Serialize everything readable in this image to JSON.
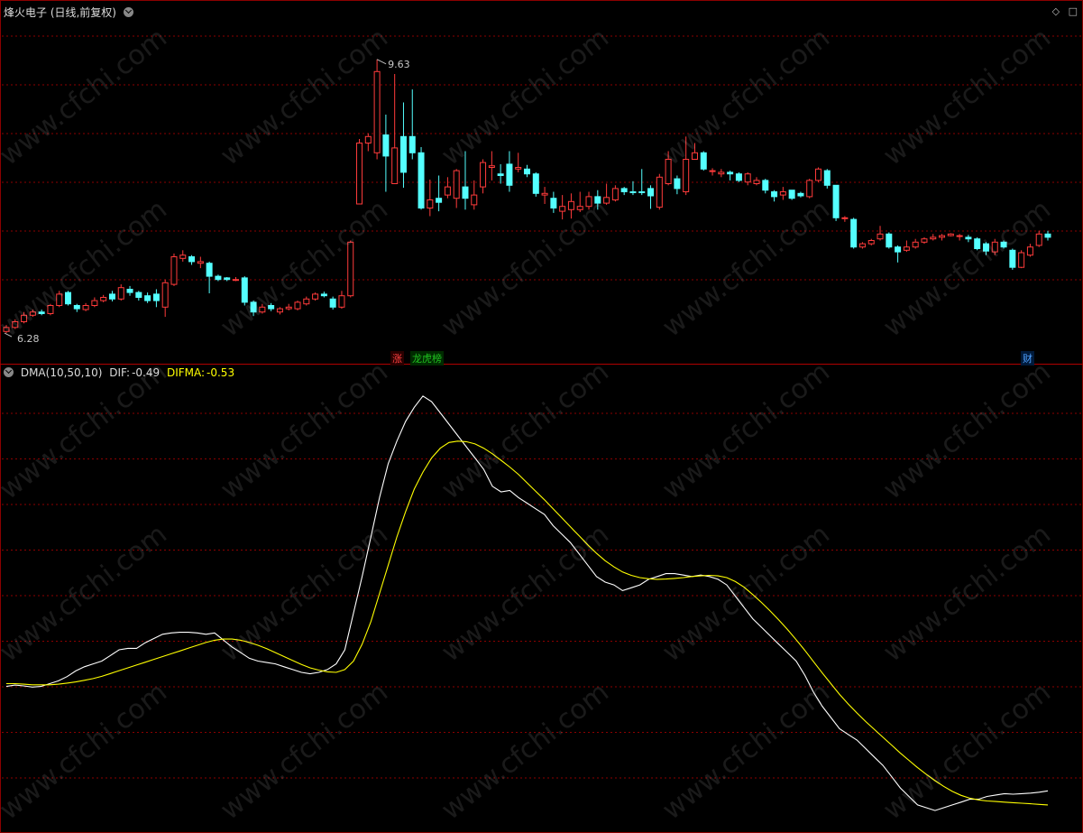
{
  "header": {
    "title": "烽火电子 (日线,前复权)"
  },
  "top_icons": [
    "diamond-icon",
    "square-icon"
  ],
  "price_panel": {
    "high_label": "9.63",
    "low_label": "6.28",
    "markers": [
      {
        "text": "涨",
        "color": "#ff4040"
      },
      {
        "text": "龙虎榜",
        "color": "#20c020"
      },
      {
        "text": "财",
        "color": "#4fa0ff"
      }
    ]
  },
  "indicator_panel": {
    "name": "DMA(10,50,10)",
    "dif_label": "DIF:",
    "dif_value": "-0.49",
    "difma_label": "DIFMA:",
    "difma_value": "-0.53"
  },
  "watermark": "www.cfchi.com",
  "colors": {
    "up": "#ff3b3b",
    "down": "#54ffff",
    "grid": "#8b0000",
    "dif": "#ffffff",
    "difma": "#ffff00",
    "text": "#c8c8c8"
  },
  "chart_data": [
    {
      "type": "candlestick",
      "title": "烽火电子 (日线,前复权)",
      "ylim": [
        6.05,
        10.05
      ],
      "candles": [
        [
          6.28,
          6.33,
          6.26,
          6.36
        ],
        [
          6.33,
          6.4,
          6.31,
          6.43
        ],
        [
          6.4,
          6.48,
          6.38,
          6.52
        ],
        [
          6.48,
          6.52,
          6.46,
          6.55
        ],
        [
          6.52,
          6.5,
          6.48,
          6.55
        ],
        [
          6.5,
          6.6,
          6.48,
          6.62
        ],
        [
          6.6,
          6.74,
          6.58,
          6.78
        ],
        [
          6.76,
          6.62,
          6.6,
          6.78
        ],
        [
          6.6,
          6.56,
          6.52,
          6.62
        ],
        [
          6.55,
          6.6,
          6.53,
          6.63
        ],
        [
          6.6,
          6.66,
          6.58,
          6.7
        ],
        [
          6.66,
          6.7,
          6.64,
          6.73
        ],
        [
          6.74,
          6.68,
          6.65,
          6.78
        ],
        [
          6.68,
          6.82,
          6.66,
          6.86
        ],
        [
          6.8,
          6.76,
          6.72,
          6.84
        ],
        [
          6.76,
          6.7,
          6.66,
          6.78
        ],
        [
          6.72,
          6.66,
          6.63,
          6.76
        ],
        [
          6.74,
          6.66,
          6.58,
          6.8
        ],
        [
          6.58,
          6.88,
          6.46,
          6.92
        ],
        [
          6.86,
          7.2,
          6.84,
          7.24
        ],
        [
          7.18,
          7.22,
          7.14,
          7.28
        ],
        [
          7.2,
          7.14,
          7.1,
          7.22
        ],
        [
          7.12,
          7.14,
          7.06,
          7.2
        ],
        [
          7.12,
          6.96,
          6.75,
          7.14
        ],
        [
          6.96,
          6.92,
          6.9,
          6.98
        ],
        [
          6.94,
          6.92,
          6.9,
          6.95
        ],
        [
          6.92,
          6.92,
          6.9,
          6.95
        ],
        [
          6.94,
          6.64,
          6.6,
          6.96
        ],
        [
          6.64,
          6.52,
          6.47,
          6.66
        ],
        [
          6.52,
          6.58,
          6.5,
          6.62
        ],
        [
          6.6,
          6.56,
          6.53,
          6.63
        ],
        [
          6.52,
          6.56,
          6.49,
          6.58
        ],
        [
          6.56,
          6.58,
          6.54,
          6.62
        ],
        [
          6.56,
          6.64,
          6.54,
          6.66
        ],
        [
          6.62,
          6.68,
          6.6,
          6.71
        ],
        [
          6.68,
          6.74,
          6.66,
          6.76
        ],
        [
          6.74,
          6.72,
          6.7,
          6.77
        ],
        [
          6.68,
          6.58,
          6.55,
          6.71
        ],
        [
          6.58,
          6.72,
          6.56,
          6.78
        ],
        [
          6.72,
          7.38,
          6.7,
          7.4
        ],
        [
          7.85,
          8.6,
          7.85,
          8.65
        ],
        [
          8.6,
          8.68,
          8.5,
          8.72
        ],
        [
          8.48,
          9.48,
          8.4,
          9.63
        ],
        [
          8.7,
          8.44,
          8.0,
          8.95
        ],
        [
          8.1,
          8.54,
          8.1,
          9.45
        ],
        [
          8.68,
          8.24,
          8.05,
          9.1
        ],
        [
          8.68,
          8.48,
          8.4,
          9.26
        ],
        [
          8.48,
          7.8,
          7.78,
          8.55
        ],
        [
          7.8,
          7.9,
          7.7,
          8.15
        ],
        [
          7.92,
          7.87,
          7.76,
          8.2
        ],
        [
          7.96,
          8.06,
          7.92,
          8.18
        ],
        [
          7.92,
          8.26,
          7.8,
          8.28
        ],
        [
          8.06,
          7.92,
          7.78,
          8.5
        ],
        [
          7.84,
          7.96,
          7.78,
          8.14
        ],
        [
          8.06,
          8.36,
          7.98,
          8.4
        ],
        [
          8.3,
          8.32,
          8.14,
          8.5
        ],
        [
          8.22,
          8.2,
          8.1,
          8.34
        ],
        [
          8.34,
          8.08,
          8.0,
          8.5
        ],
        [
          8.28,
          8.3,
          8.24,
          8.48
        ],
        [
          8.28,
          8.22,
          8.18,
          8.33
        ],
        [
          8.22,
          7.98,
          7.94,
          8.24
        ],
        [
          7.96,
          7.98,
          7.85,
          8.06
        ],
        [
          7.92,
          7.8,
          7.74,
          8.0
        ],
        [
          7.76,
          7.82,
          7.66,
          7.96
        ],
        [
          7.78,
          7.88,
          7.67,
          7.98
        ],
        [
          7.78,
          7.82,
          7.75,
          8.0
        ],
        [
          7.82,
          7.94,
          7.78,
          8.0
        ],
        [
          7.94,
          7.86,
          7.78,
          8.02
        ],
        [
          7.86,
          7.93,
          7.84,
          8.1
        ],
        [
          7.9,
          8.04,
          7.88,
          8.08
        ],
        [
          8.04,
          8.0,
          7.96,
          8.06
        ],
        [
          8.0,
          7.99,
          7.96,
          8.13
        ],
        [
          8.0,
          7.99,
          7.96,
          8.28
        ],
        [
          8.04,
          7.95,
          7.79,
          8.08
        ],
        [
          7.81,
          8.18,
          7.78,
          8.22
        ],
        [
          8.1,
          8.4,
          8.08,
          8.5
        ],
        [
          8.16,
          8.04,
          7.97,
          8.2
        ],
        [
          8.0,
          8.4,
          7.96,
          8.68
        ],
        [
          8.4,
          8.48,
          8.4,
          8.6
        ],
        [
          8.48,
          8.28,
          8.26,
          8.5
        ],
        [
          8.26,
          8.26,
          8.2,
          8.29
        ],
        [
          8.22,
          8.24,
          8.18,
          8.28
        ],
        [
          8.24,
          8.22,
          8.14,
          8.26
        ],
        [
          8.22,
          8.14,
          8.12,
          8.24
        ],
        [
          8.12,
          8.22,
          8.08,
          8.24
        ],
        [
          8.1,
          8.14,
          8.08,
          8.18
        ],
        [
          8.14,
          8.02,
          7.98,
          8.16
        ],
        [
          8.0,
          7.94,
          7.88,
          8.02
        ],
        [
          7.96,
          8.0,
          7.9,
          8.06
        ],
        [
          8.02,
          7.92,
          7.9,
          8.02
        ],
        [
          7.98,
          7.95,
          7.93,
          8.0
        ],
        [
          7.94,
          8.14,
          7.92,
          8.16
        ],
        [
          8.14,
          8.28,
          8.12,
          8.3
        ],
        [
          8.26,
          8.08,
          8.04,
          8.28
        ],
        [
          8.08,
          7.68,
          7.64,
          8.08
        ],
        [
          7.68,
          7.68,
          7.63,
          7.7
        ],
        [
          7.66,
          7.32,
          7.3,
          7.68
        ],
        [
          7.32,
          7.36,
          7.3,
          7.38
        ],
        [
          7.36,
          7.4,
          7.34,
          7.42
        ],
        [
          7.42,
          7.48,
          7.4,
          7.58
        ],
        [
          7.48,
          7.32,
          7.3,
          7.5
        ],
        [
          7.32,
          7.26,
          7.13,
          7.34
        ],
        [
          7.28,
          7.32,
          7.26,
          7.4
        ],
        [
          7.32,
          7.38,
          7.3,
          7.42
        ],
        [
          7.38,
          7.42,
          7.36,
          7.44
        ],
        [
          7.42,
          7.44,
          7.4,
          7.48
        ],
        [
          7.44,
          7.46,
          7.4,
          7.48
        ],
        [
          7.46,
          7.48,
          7.45,
          7.49
        ],
        [
          7.46,
          7.46,
          7.4,
          7.48
        ],
        [
          7.44,
          7.42,
          7.38,
          7.47
        ],
        [
          7.42,
          7.3,
          7.28,
          7.44
        ],
        [
          7.36,
          7.27,
          7.22,
          7.38
        ],
        [
          7.26,
          7.38,
          7.22,
          7.42
        ],
        [
          7.38,
          7.32,
          7.3,
          7.4
        ],
        [
          7.28,
          7.07,
          7.04,
          7.3
        ],
        [
          7.07,
          7.25,
          7.06,
          7.28
        ],
        [
          7.22,
          7.32,
          7.2,
          7.36
        ],
        [
          7.34,
          7.48,
          7.32,
          7.52
        ],
        [
          7.48,
          7.44,
          7.4,
          7.52
        ]
      ]
    },
    {
      "type": "line",
      "title": "DMA(10,50,10)",
      "ylim": [
        -0.62,
        0.98
      ],
      "series": [
        {
          "name": "DIF",
          "color": "#ffffff",
          "values": [
            -0.11,
            -0.105,
            -0.108,
            -0.112,
            -0.11,
            -0.1,
            -0.09,
            -0.075,
            -0.055,
            -0.04,
            -0.03,
            -0.02,
            0.0,
            0.02,
            0.025,
            0.025,
            0.045,
            0.06,
            0.075,
            0.08,
            0.082,
            0.082,
            0.08,
            0.075,
            0.08,
            0.055,
            0.03,
            0.01,
            -0.01,
            -0.02,
            -0.025,
            -0.03,
            -0.04,
            -0.05,
            -0.06,
            -0.065,
            -0.06,
            -0.05,
            -0.03,
            0.02,
            0.15,
            0.28,
            0.42,
            0.56,
            0.68,
            0.76,
            0.83,
            0.88,
            0.92,
            0.9,
            0.86,
            0.82,
            0.78,
            0.74,
            0.7,
            0.66,
            0.6,
            0.58,
            0.585,
            0.56,
            0.54,
            0.52,
            0.5,
            0.46,
            0.43,
            0.4,
            0.36,
            0.32,
            0.28,
            0.26,
            0.25,
            0.23,
            0.24,
            0.25,
            0.27,
            0.28,
            0.29,
            0.29,
            0.285,
            0.28,
            0.285,
            0.28,
            0.27,
            0.25,
            0.21,
            0.17,
            0.13,
            0.1,
            0.07,
            0.04,
            0.01,
            -0.02,
            -0.07,
            -0.13,
            -0.18,
            -0.22,
            -0.26,
            -0.28,
            -0.3,
            -0.33,
            -0.36,
            -0.39,
            -0.43,
            -0.47,
            -0.5,
            -0.53,
            -0.54,
            -0.55,
            -0.54,
            -0.53,
            -0.52,
            -0.51,
            -0.51,
            -0.5,
            -0.495,
            -0.49,
            -0.492,
            -0.49,
            -0.488,
            -0.485,
            -0.48
          ]
        },
        {
          "name": "DIFMA",
          "color": "#ffff00",
          "values": [
            -0.1,
            -0.1,
            -0.102,
            -0.104,
            -0.104,
            -0.104,
            -0.102,
            -0.098,
            -0.094,
            -0.088,
            -0.082,
            -0.074,
            -0.064,
            -0.054,
            -0.044,
            -0.034,
            -0.024,
            -0.014,
            -0.004,
            0.006,
            0.016,
            0.026,
            0.036,
            0.046,
            0.054,
            0.058,
            0.058,
            0.054,
            0.046,
            0.036,
            0.024,
            0.01,
            -0.004,
            -0.018,
            -0.032,
            -0.044,
            -0.052,
            -0.058,
            -0.06,
            -0.05,
            -0.02,
            0.04,
            0.12,
            0.22,
            0.32,
            0.42,
            0.51,
            0.59,
            0.65,
            0.7,
            0.735,
            0.755,
            0.76,
            0.758,
            0.75,
            0.735,
            0.715,
            0.692,
            0.668,
            0.642,
            0.612,
            0.582,
            0.552,
            0.52,
            0.488,
            0.456,
            0.424,
            0.392,
            0.362,
            0.336,
            0.314,
            0.296,
            0.284,
            0.276,
            0.272,
            0.27,
            0.271,
            0.273,
            0.276,
            0.28,
            0.282,
            0.284,
            0.282,
            0.276,
            0.262,
            0.242,
            0.216,
            0.188,
            0.158,
            0.126,
            0.092,
            0.056,
            0.018,
            -0.022,
            -0.062,
            -0.1,
            -0.138,
            -0.172,
            -0.204,
            -0.234,
            -0.262,
            -0.29,
            -0.318,
            -0.346,
            -0.372,
            -0.398,
            -0.422,
            -0.444,
            -0.464,
            -0.482,
            -0.496,
            -0.506,
            -0.512,
            -0.516,
            -0.518,
            -0.52,
            -0.522,
            -0.524,
            -0.526,
            -0.528,
            -0.53
          ]
        }
      ]
    }
  ]
}
